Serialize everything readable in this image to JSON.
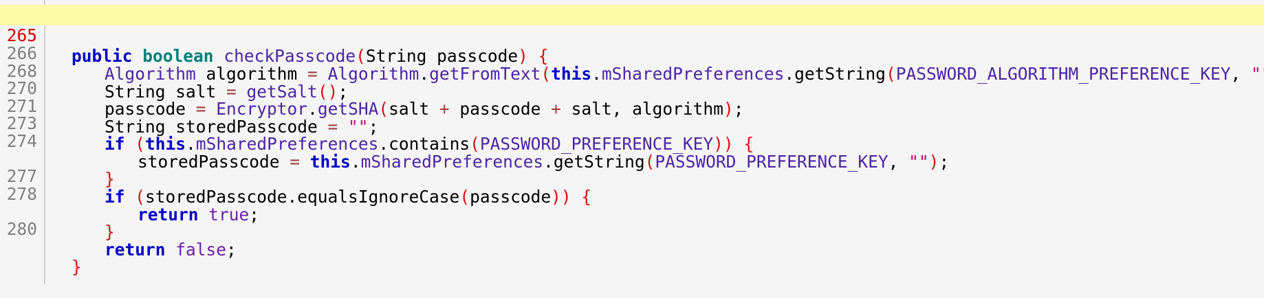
{
  "gutter": {
    "line_numbers": [
      "265",
      "266",
      "268",
      "270",
      "271",
      "273",
      "274",
      "",
      "277",
      "278",
      "",
      "280",
      ""
    ]
  },
  "code": {
    "lines": [
      {
        "tokens": [
          {
            "c": "kw",
            "t": "public"
          },
          {
            "c": "t",
            "t": " "
          },
          {
            "c": "kwt",
            "t": "boolean"
          },
          {
            "c": "t",
            "t": " "
          },
          {
            "c": "m",
            "t": "checkPasscode"
          },
          {
            "c": "p",
            "t": "("
          },
          {
            "c": "t",
            "t": "String passcode"
          },
          {
            "c": "p",
            "t": ")"
          },
          {
            "c": "t",
            "t": " "
          },
          {
            "c": "p",
            "t": "{"
          }
        ]
      },
      {
        "tokens": [
          {
            "c": "id",
            "t": "Algorithm"
          },
          {
            "c": "t",
            "t": " algorithm "
          },
          {
            "c": "op",
            "t": "="
          },
          {
            "c": "t",
            "t": " "
          },
          {
            "c": "id",
            "t": "Algorithm"
          },
          {
            "c": "t",
            "t": "."
          },
          {
            "c": "m",
            "t": "getFromText"
          },
          {
            "c": "p",
            "t": "("
          },
          {
            "c": "kw",
            "t": "this"
          },
          {
            "c": "t",
            "t": "."
          },
          {
            "c": "id",
            "t": "mSharedPreferences"
          },
          {
            "c": "t",
            "t": ".getString"
          },
          {
            "c": "p",
            "t": "("
          },
          {
            "c": "id",
            "t": "PASSWORD_ALGORITHM_PREFERENCE_KEY"
          },
          {
            "c": "t",
            "t": ", "
          },
          {
            "c": "s",
            "t": "\"\""
          },
          {
            "c": "p",
            "t": "))"
          },
          {
            "c": "t",
            "t": ";"
          }
        ]
      },
      {
        "tokens": [
          {
            "c": "t",
            "t": "String salt "
          },
          {
            "c": "op",
            "t": "="
          },
          {
            "c": "t",
            "t": " "
          },
          {
            "c": "m",
            "t": "getSalt"
          },
          {
            "c": "p",
            "t": "()"
          },
          {
            "c": "t",
            "t": ";"
          }
        ]
      },
      {
        "tokens": [
          {
            "c": "t",
            "t": "passcode "
          },
          {
            "c": "op",
            "t": "="
          },
          {
            "c": "t",
            "t": " "
          },
          {
            "c": "id",
            "t": "Encryptor"
          },
          {
            "c": "t",
            "t": "."
          },
          {
            "c": "m",
            "t": "getSHA"
          },
          {
            "c": "p",
            "t": "("
          },
          {
            "c": "t",
            "t": "salt "
          },
          {
            "c": "op",
            "t": "+"
          },
          {
            "c": "t",
            "t": " passcode "
          },
          {
            "c": "op",
            "t": "+"
          },
          {
            "c": "t",
            "t": " salt, algorithm"
          },
          {
            "c": "p",
            "t": ")"
          },
          {
            "c": "t",
            "t": ";"
          }
        ]
      },
      {
        "tokens": [
          {
            "c": "t",
            "t": "String storedPasscode "
          },
          {
            "c": "op",
            "t": "="
          },
          {
            "c": "t",
            "t": " "
          },
          {
            "c": "s",
            "t": "\"\""
          },
          {
            "c": "t",
            "t": ";"
          }
        ]
      },
      {
        "tokens": [
          {
            "c": "kw",
            "t": "if"
          },
          {
            "c": "t",
            "t": " "
          },
          {
            "c": "p",
            "t": "("
          },
          {
            "c": "kw",
            "t": "this"
          },
          {
            "c": "t",
            "t": "."
          },
          {
            "c": "id",
            "t": "mSharedPreferences"
          },
          {
            "c": "t",
            "t": ".contains"
          },
          {
            "c": "p",
            "t": "("
          },
          {
            "c": "id",
            "t": "PASSWORD_PREFERENCE_KEY"
          },
          {
            "c": "p",
            "t": "))"
          },
          {
            "c": "t",
            "t": " "
          },
          {
            "c": "p",
            "t": "{"
          }
        ]
      },
      {
        "tokens": [
          {
            "c": "t",
            "t": "storedPasscode "
          },
          {
            "c": "op",
            "t": "="
          },
          {
            "c": "t",
            "t": " "
          },
          {
            "c": "kw",
            "t": "this"
          },
          {
            "c": "t",
            "t": "."
          },
          {
            "c": "id",
            "t": "mSharedPreferences"
          },
          {
            "c": "t",
            "t": ".getString"
          },
          {
            "c": "p",
            "t": "("
          },
          {
            "c": "id",
            "t": "PASSWORD_PREFERENCE_KEY"
          },
          {
            "c": "t",
            "t": ", "
          },
          {
            "c": "s",
            "t": "\"\""
          },
          {
            "c": "p",
            "t": ")"
          },
          {
            "c": "t",
            "t": ";"
          }
        ]
      },
      {
        "tokens": [
          {
            "c": "p",
            "t": "}"
          }
        ]
      },
      {
        "tokens": [
          {
            "c": "kw",
            "t": "if"
          },
          {
            "c": "t",
            "t": " "
          },
          {
            "c": "p",
            "t": "("
          },
          {
            "c": "t",
            "t": "storedPasscode.equalsIgnoreCase"
          },
          {
            "c": "p",
            "t": "("
          },
          {
            "c": "t",
            "t": "passcode"
          },
          {
            "c": "p",
            "t": "))"
          },
          {
            "c": "t",
            "t": " "
          },
          {
            "c": "p",
            "t": "{"
          }
        ]
      },
      {
        "tokens": [
          {
            "c": "kw",
            "t": "return"
          },
          {
            "c": "t",
            "t": " "
          },
          {
            "c": "kwl",
            "t": "true"
          },
          {
            "c": "t",
            "t": ";"
          }
        ]
      },
      {
        "tokens": [
          {
            "c": "p",
            "t": "}"
          }
        ]
      },
      {
        "tokens": [
          {
            "c": "kw",
            "t": "return"
          },
          {
            "c": "t",
            "t": " "
          },
          {
            "c": "kwl",
            "t": "false"
          },
          {
            "c": "t",
            "t": ";"
          }
        ]
      },
      {
        "tokens": [
          {
            "c": "p",
            "t": "}"
          }
        ]
      }
    ]
  },
  "colors": {
    "highlight_bg": "#fdfba4",
    "keyword": "#0000c8",
    "type_keyword": "#00807a",
    "identifier": "#4d24a4",
    "paren": "#d81010",
    "string": "#c8007a",
    "line_number": "#808080",
    "current_line_number": "#d00000"
  }
}
